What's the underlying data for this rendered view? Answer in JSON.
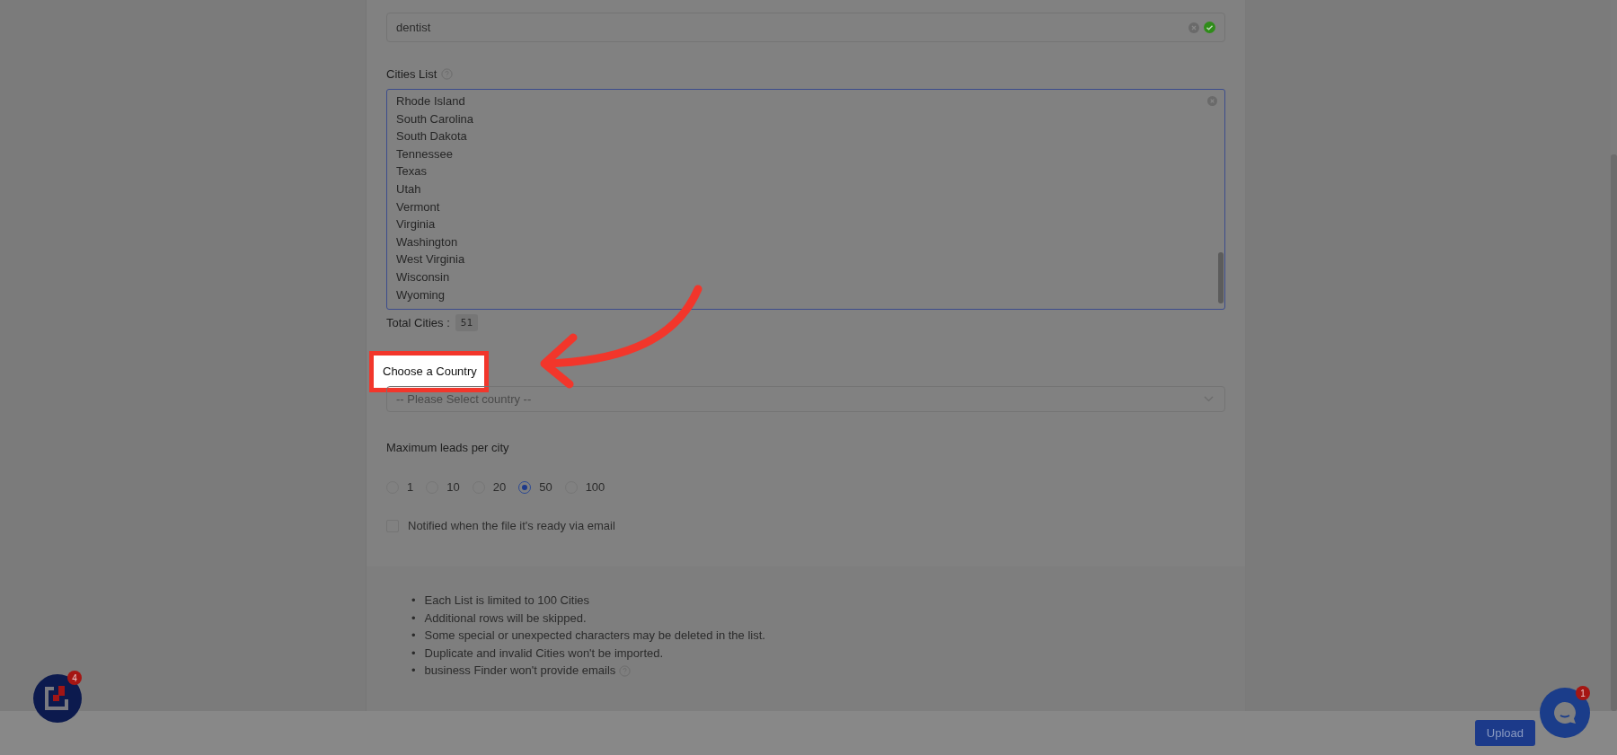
{
  "keyword_field": {
    "value": "dentist",
    "valid": true
  },
  "cities": {
    "label": "Cities List",
    "lines": [
      "Rhode Island",
      "South Carolina",
      "South Dakota",
      "Tennessee",
      "Texas",
      "Utah",
      "Vermont",
      "Virginia",
      "Washington",
      "West Virginia",
      "Wisconsin",
      "Wyoming"
    ],
    "total_label": "Total Cities :",
    "total": "51"
  },
  "country": {
    "label": "Choose a Country",
    "highlighted": true,
    "placeholder": "-- Please Select country --"
  },
  "max_leads": {
    "label": "Maximum leads per city",
    "options": [
      {
        "label": "1",
        "selected": false
      },
      {
        "label": "10",
        "selected": false
      },
      {
        "label": "20",
        "selected": false
      },
      {
        "label": "50",
        "selected": true
      },
      {
        "label": "100",
        "selected": false
      }
    ]
  },
  "notify": {
    "label": "Notified when the file it's ready via email",
    "checked": false
  },
  "notes": [
    {
      "marker": "•",
      "text": "Each List is limited to 100 Cities"
    },
    {
      "marker": "•",
      "text": "Additional rows will be skipped."
    },
    {
      "marker": "•",
      "text": "Some special or unexpected characters may be deleted in the list."
    },
    {
      "marker": "•",
      "text": "Duplicate and invalid Cities won't be imported."
    },
    {
      "marker": "•",
      "text": "business Finder won't provide emails"
    }
  ],
  "widget_badge": "4",
  "chat_badge": "1",
  "upload_button": "Upload"
}
